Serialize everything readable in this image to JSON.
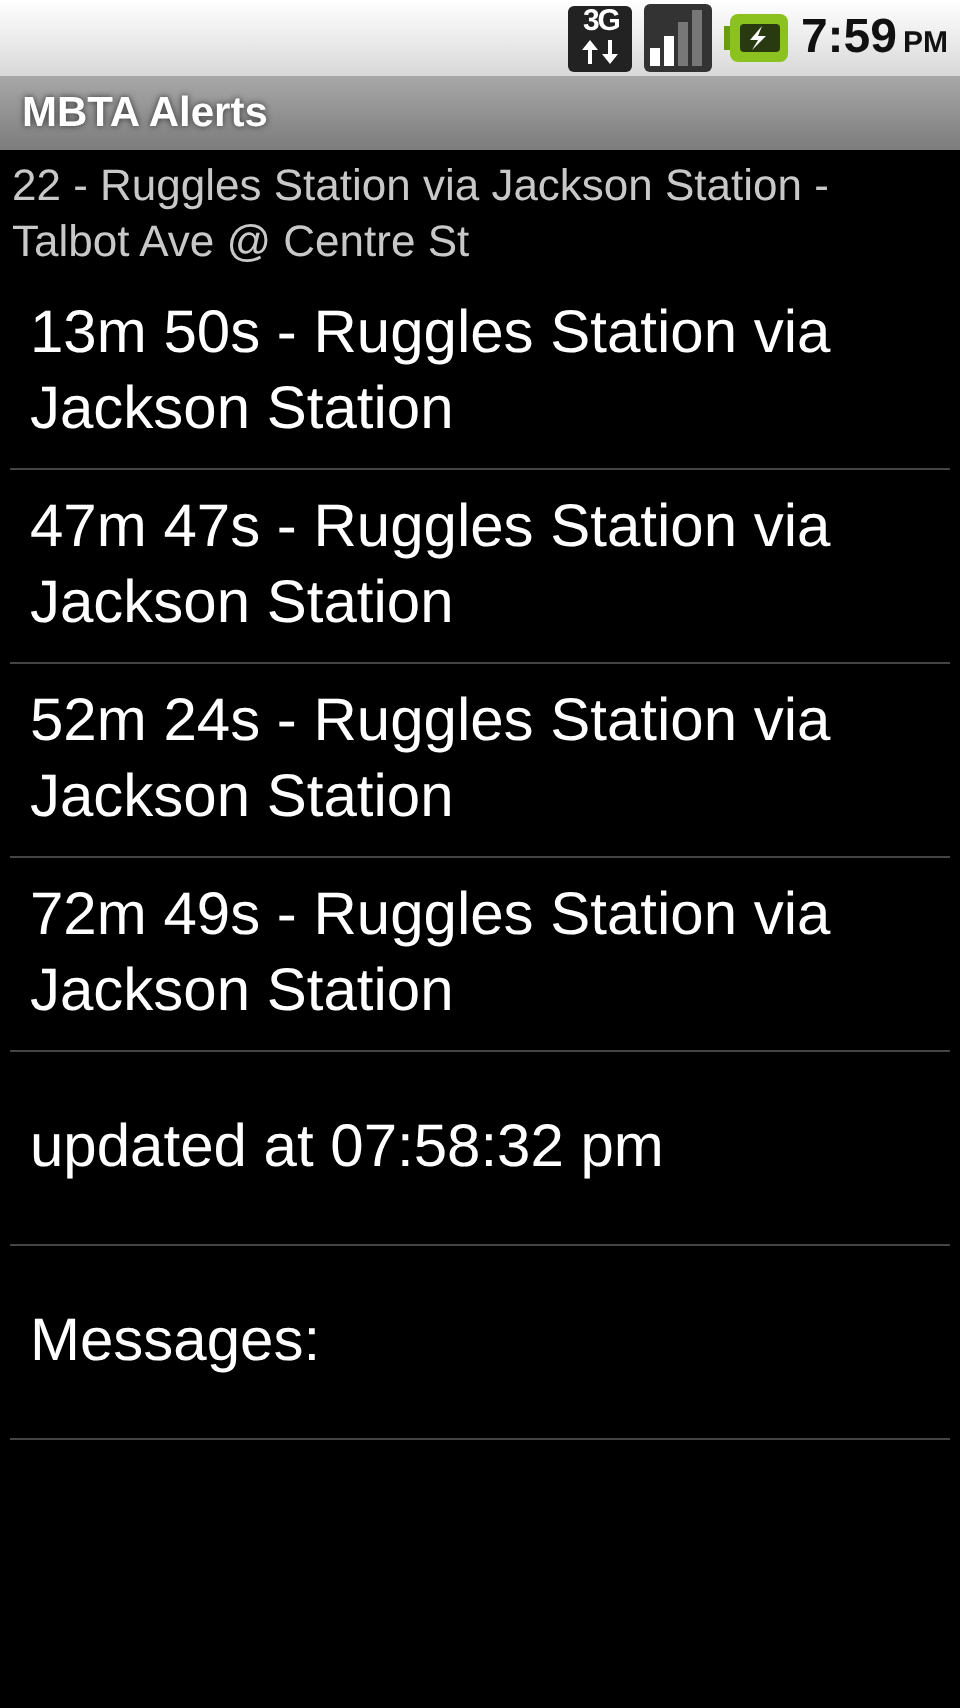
{
  "status_bar": {
    "network": "3G",
    "time": "7:59",
    "period": "PM"
  },
  "window": {
    "title": "MBTA Alerts"
  },
  "subtitle": "22 - Ruggles Station via Jackson Station - Talbot Ave @ Centre St",
  "rows": [
    {
      "text": "13m 50s - Ruggles Station via Jackson Station"
    },
    {
      "text": "47m 47s - Ruggles Station via Jackson Station"
    },
    {
      "text": "52m 24s - Ruggles Station via Jackson Station"
    },
    {
      "text": "72m 49s - Ruggles Station via Jackson Station"
    },
    {
      "text": "updated at 07:58:32 pm"
    },
    {
      "text": "Messages:"
    }
  ]
}
